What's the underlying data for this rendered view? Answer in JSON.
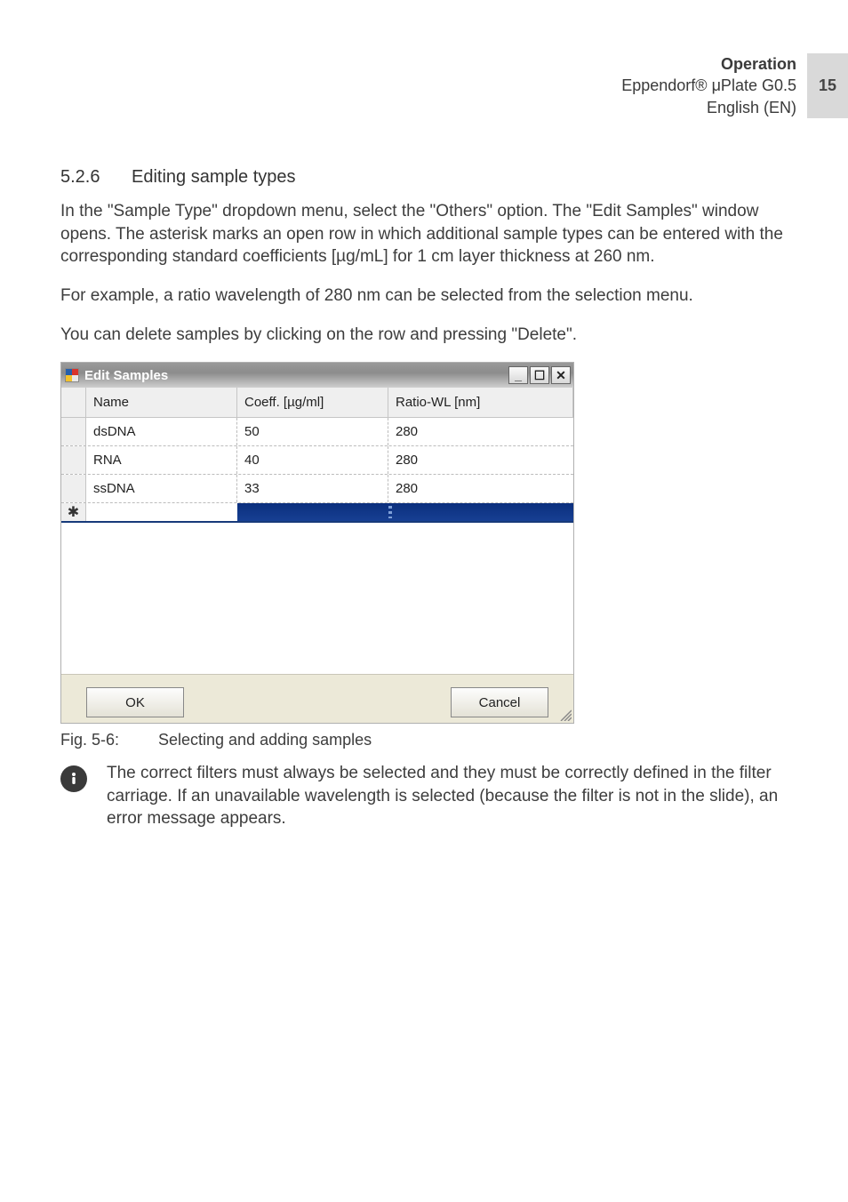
{
  "header": {
    "line1": "Operation",
    "line2": "Eppendorf® μPlate G0.5",
    "line3": "English (EN)",
    "page_number": "15"
  },
  "section": {
    "number": "5.2.6",
    "title": "Editing sample types"
  },
  "paragraphs": {
    "p1": "In the \"Sample Type\" dropdown menu, select the \"Others\" option. The \"Edit Samples\" window opens. The asterisk marks an open row in which additional sample types can be entered with the corresponding standard coefficients [µg/mL] for 1 cm layer thickness at 260 nm.",
    "p2": "For example, a ratio wavelength of 280 nm can be selected from the selection menu.",
    "p3": "You can delete samples by clicking on the row and pressing \"Delete\"."
  },
  "dialog": {
    "title": "Edit Samples",
    "headers": {
      "name": "Name",
      "coeff": "Coeff. [µg/ml]",
      "ratio": "Ratio-WL [nm]"
    },
    "rows": [
      {
        "name": "dsDNA",
        "coeff": "50",
        "ratio": "280"
      },
      {
        "name": "RNA",
        "coeff": "40",
        "ratio": "280"
      },
      {
        "name": "ssDNA",
        "coeff": "33",
        "ratio": "280"
      }
    ],
    "new_row_marker": "✱",
    "buttons": {
      "ok": "OK",
      "cancel": "Cancel"
    },
    "window_buttons": {
      "min": "_",
      "max": "☐",
      "close": "✕"
    }
  },
  "figure": {
    "number": "Fig. 5-6:",
    "caption": "Selecting and adding samples"
  },
  "note": {
    "text": "The correct filters must always be selected and they must be correctly defined in the filter carriage. If an unavailable wavelength is selected (because the filter is not in the slide), an error message appears."
  }
}
